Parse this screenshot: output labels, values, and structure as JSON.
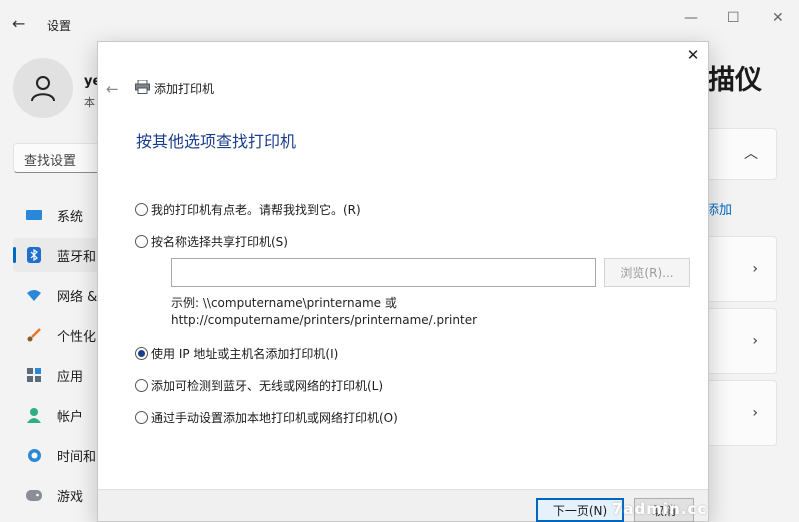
{
  "window": {
    "back_icon": "arrow-left-icon",
    "title": "设置",
    "controls": {
      "minimize": "—",
      "maximize": "☐",
      "close": "✕"
    }
  },
  "user": {
    "name": "ye",
    "subtitle": "本",
    "avatar_icon": "person-icon"
  },
  "search": {
    "placeholder": "查找设置"
  },
  "sidebar": {
    "items": [
      {
        "label": "系统",
        "icon": "monitor-icon"
      },
      {
        "label": "蓝牙和",
        "icon": "bluetooth-icon",
        "active": true
      },
      {
        "label": "网络 &",
        "icon": "wifi-icon"
      },
      {
        "label": "个性化",
        "icon": "brush-icon"
      },
      {
        "label": "应用",
        "icon": "apps-icon"
      },
      {
        "label": "帐户",
        "icon": "account-icon"
      },
      {
        "label": "时间和",
        "icon": "clock-globe-icon"
      },
      {
        "label": "游戏",
        "icon": "gamepad-icon"
      }
    ]
  },
  "right_panel": {
    "heading": "描仪",
    "link": "添加",
    "expand_icon": "chevron-up-icon",
    "row_icon": "chevron-right-icon"
  },
  "dialog": {
    "close": "✕",
    "title": "添加打印机",
    "heading": "按其他选项查找打印机",
    "options": [
      {
        "label": "我的打印机有点老。请帮我找到它。(R)",
        "checked": false
      },
      {
        "label": "按名称选择共享打印机(S)",
        "checked": false
      },
      {
        "label": "使用 IP 地址或主机名添加打印机(I)",
        "checked": true
      },
      {
        "label": "添加可检测到蓝牙、无线或网络的打印机(L)",
        "checked": false
      },
      {
        "label": "通过手动设置添加本地打印机或网络打印机(O)",
        "checked": false
      }
    ],
    "share_input_value": "",
    "browse_label": "浏览(R)...",
    "example_line1": "示例: \\\\computername\\printername 或",
    "example_line2": "http://computername/printers/printername/.printer",
    "next_label": "下一页(N)",
    "cancel_label": "取消"
  },
  "watermark": "7admin.cc",
  "colors": {
    "accent": "#0067c0",
    "heading_blue": "#1a3e8c"
  }
}
